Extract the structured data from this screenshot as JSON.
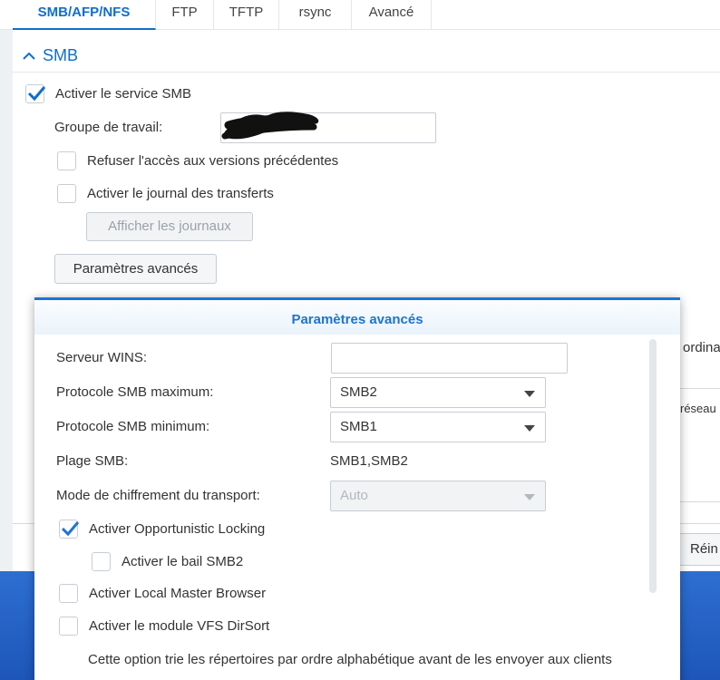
{
  "tabs": [
    {
      "label": "SMB/AFP/NFS",
      "active": true
    },
    {
      "label": "FTP",
      "active": false
    },
    {
      "label": "TFTP",
      "active": false
    },
    {
      "label": "rsync",
      "active": false
    },
    {
      "label": "Avancé",
      "active": false
    }
  ],
  "smb_section": {
    "title": "SMB",
    "enable_label": "Activer le service SMB",
    "enable_checked": true,
    "workgroup_label": "Groupe de travail:",
    "workgroup_value": "",
    "deny_previous_label": "Refuser l'accès aux versions précédentes",
    "deny_previous_checked": false,
    "transfer_log_label": "Activer le journal des transferts",
    "transfer_log_checked": false,
    "show_logs_button": "Afficher les journaux",
    "advanced_button": "Paramètres avancés"
  },
  "background_fragments": {
    "right_text_1": "ordina",
    "right_text_2": "réseau",
    "reset_button": "Réin"
  },
  "dialog": {
    "title": "Paramètres avancés",
    "wins_label": "Serveur WINS:",
    "wins_value": "",
    "max_protocol_label": "Protocole SMB maximum:",
    "max_protocol_value": "SMB2",
    "min_protocol_label": "Protocole SMB minimum:",
    "min_protocol_value": "SMB1",
    "range_label": "Plage SMB:",
    "range_value": "SMB1,SMB2",
    "encryption_label": "Mode de chiffrement du transport:",
    "encryption_value": "Auto",
    "oplocks_label": "Activer Opportunistic Locking",
    "oplocks_checked": true,
    "lease_label": "Activer le bail SMB2",
    "lease_checked": false,
    "local_master_label": "Activer Local Master Browser",
    "local_master_checked": false,
    "dirsort_label": "Activer le module VFS DirSort",
    "dirsort_checked": false,
    "dirsort_description": "Cette option trie les répertoires par ordre alphabétique avant de les envoyer aux clients"
  },
  "colors": {
    "accent": "#0f6ecd",
    "dialog_accent": "#1c74d4",
    "desktop_blue": "#2d6fd1"
  }
}
